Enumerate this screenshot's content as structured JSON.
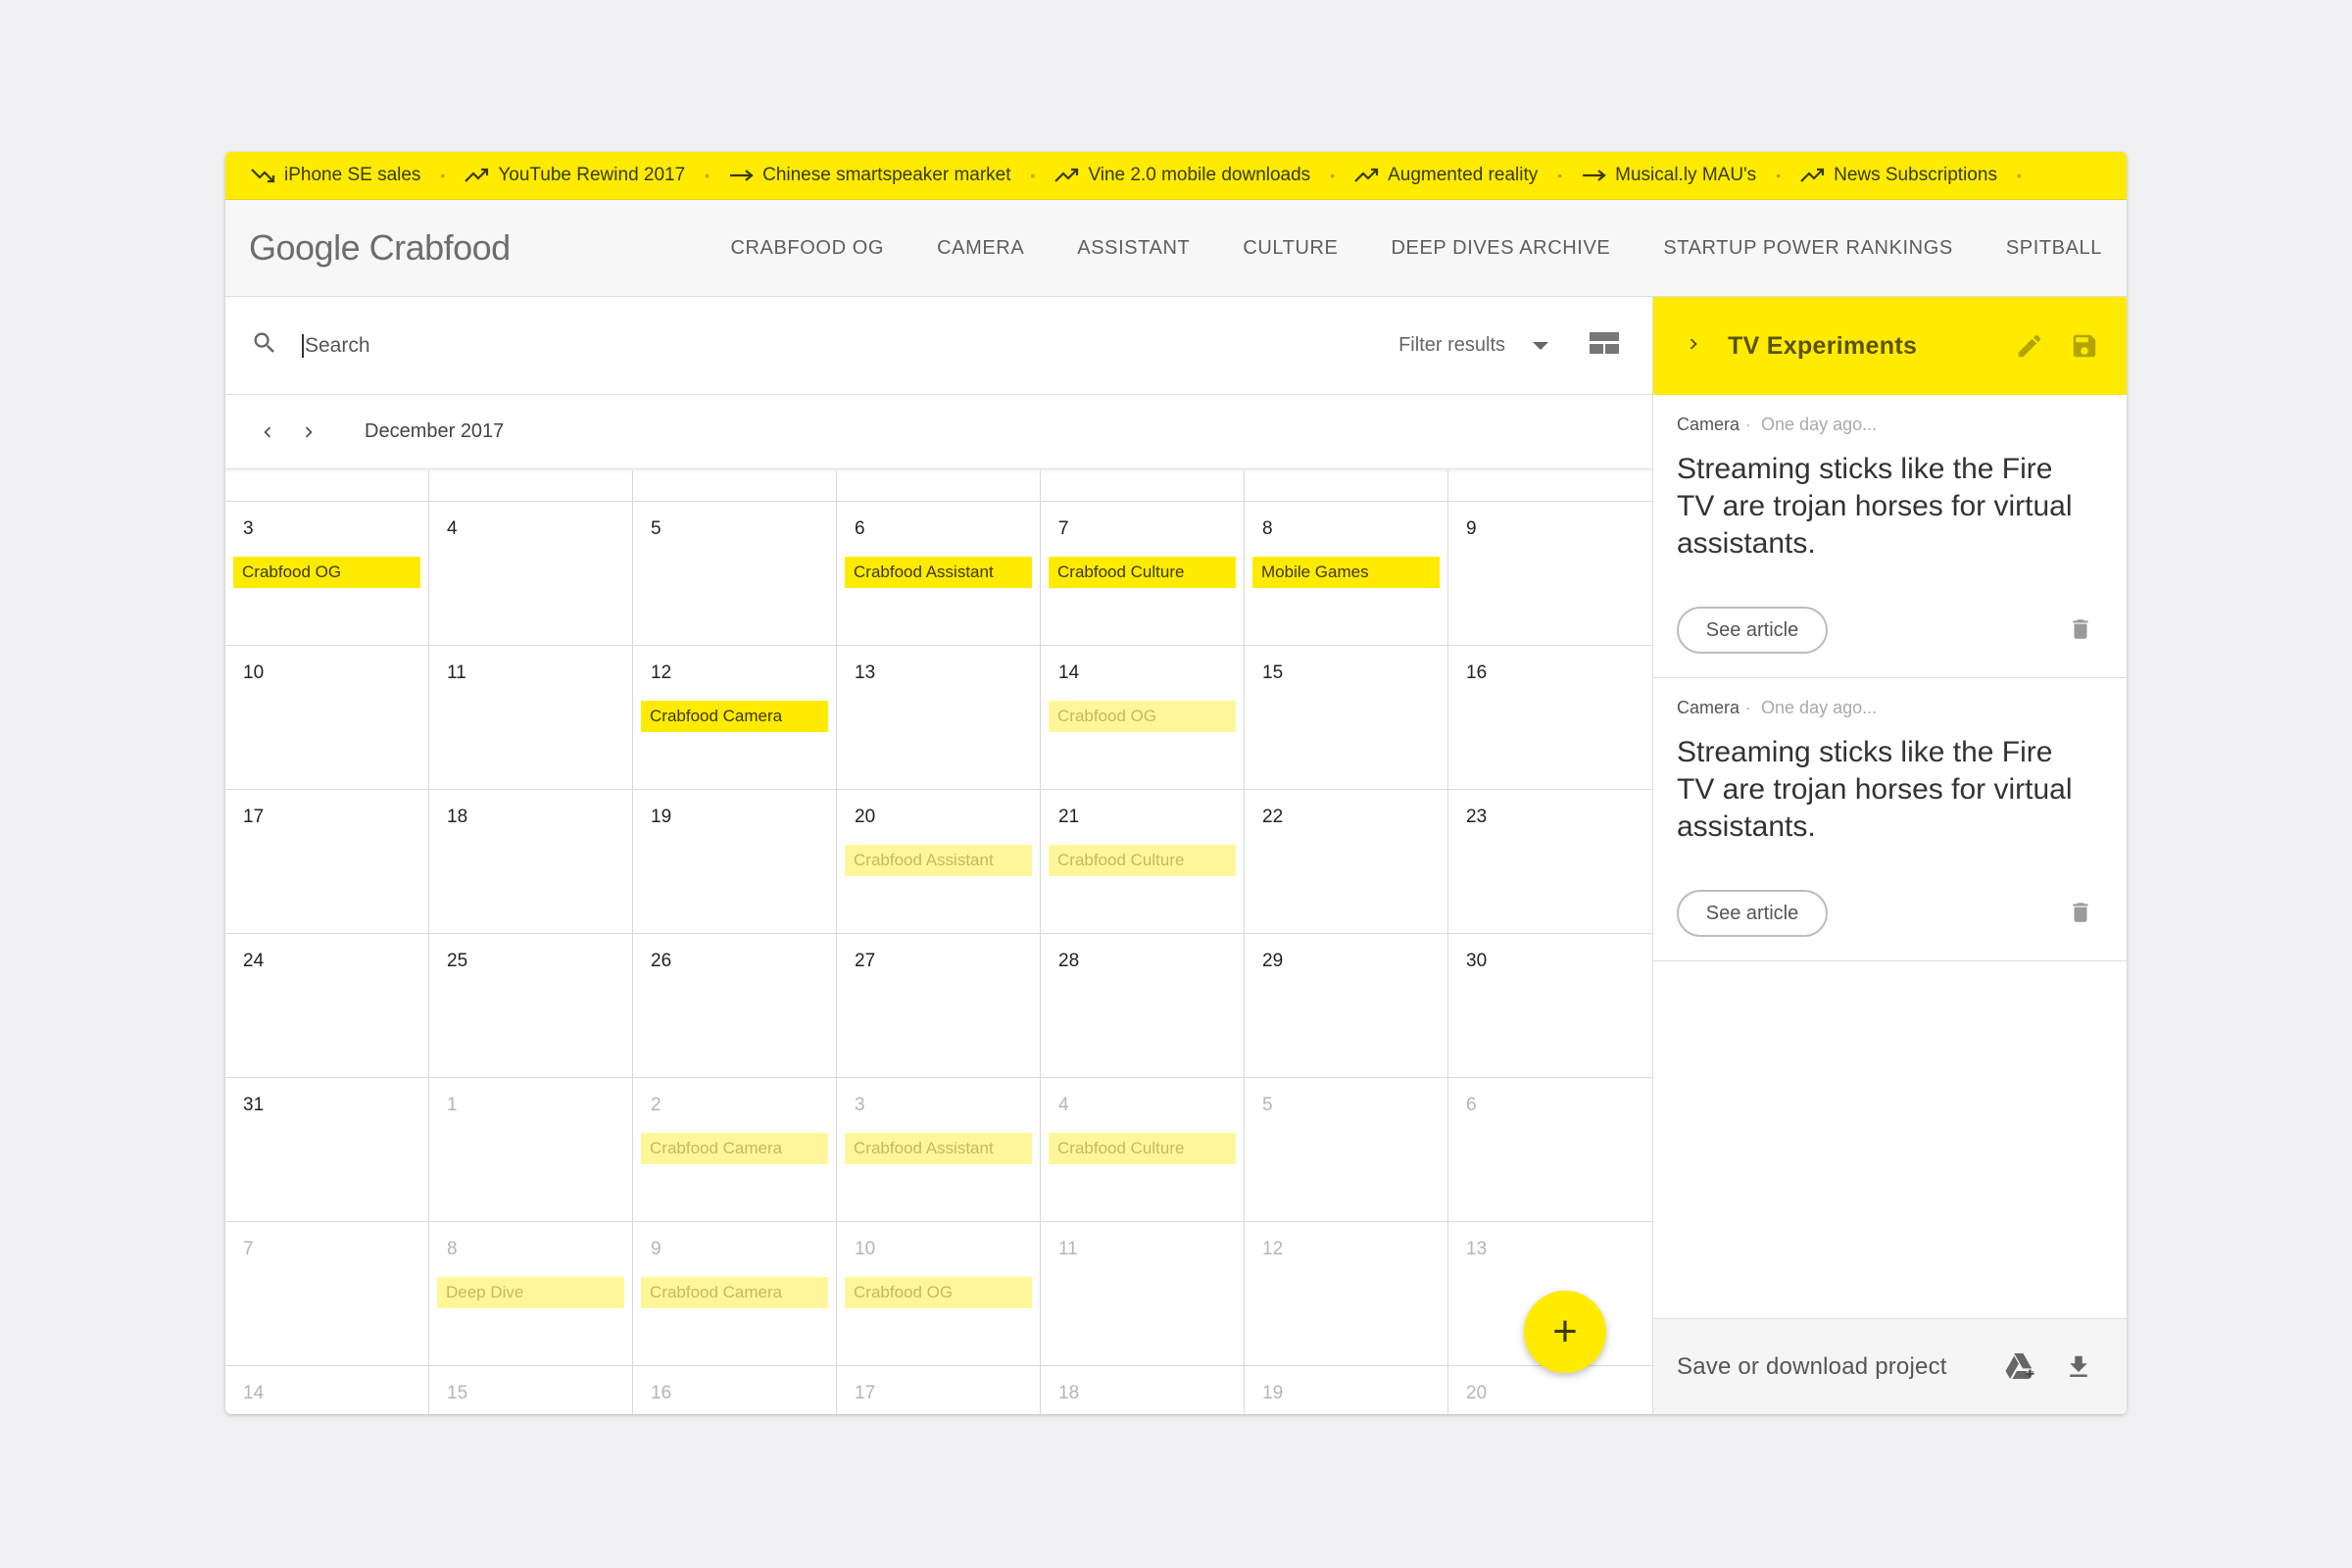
{
  "ticker": [
    {
      "label": "iPhone SE sales",
      "trend": "down"
    },
    {
      "label": "YouTube Rewind 2017",
      "trend": "up"
    },
    {
      "label": "Chinese smartspeaker market",
      "trend": "flat"
    },
    {
      "label": "Vine 2.0 mobile downloads",
      "trend": "up"
    },
    {
      "label": "Augmented reality",
      "trend": "up"
    },
    {
      "label": "Musical.ly MAU's",
      "trend": "flat"
    },
    {
      "label": "News Subscriptions",
      "trend": "up"
    }
  ],
  "header": {
    "logo": "Google Crabfood",
    "nav": [
      "CRABFOOD OG",
      "CAMERA",
      "ASSISTANT",
      "CULTURE",
      "DEEP DIVES ARCHIVE",
      "STARTUP POWER RANKINGS",
      "SPITBALL"
    ]
  },
  "search": {
    "placeholder": "Search",
    "filter_label": "Filter results"
  },
  "calendar": {
    "month_label": "December 2017",
    "weeks": [
      [
        {
          "d": "3",
          "dim": false,
          "ev": "Crabfood OG",
          "evDim": false
        },
        {
          "d": "4",
          "dim": false
        },
        {
          "d": "5",
          "dim": false
        },
        {
          "d": "6",
          "dim": false,
          "ev": "Crabfood Assistant",
          "evDim": false
        },
        {
          "d": "7",
          "dim": false,
          "ev": "Crabfood Culture",
          "evDim": false
        },
        {
          "d": "8",
          "dim": false,
          "ev": "Mobile Games",
          "evDim": false
        },
        {
          "d": "9",
          "dim": false
        }
      ],
      [
        {
          "d": "10",
          "dim": false
        },
        {
          "d": "11",
          "dim": false
        },
        {
          "d": "12",
          "dim": false,
          "ev": "Crabfood Camera",
          "evDim": false
        },
        {
          "d": "13",
          "dim": false
        },
        {
          "d": "14",
          "dim": false,
          "ev": "Crabfood OG",
          "evDim": true
        },
        {
          "d": "15",
          "dim": false
        },
        {
          "d": "16",
          "dim": false
        }
      ],
      [
        {
          "d": "17",
          "dim": false
        },
        {
          "d": "18",
          "dim": false
        },
        {
          "d": "19",
          "dim": false
        },
        {
          "d": "20",
          "dim": false,
          "ev": "Crabfood Assistant",
          "evDim": true
        },
        {
          "d": "21",
          "dim": false,
          "ev": "Crabfood Culture",
          "evDim": true
        },
        {
          "d": "22",
          "dim": false
        },
        {
          "d": "23",
          "dim": false
        }
      ],
      [
        {
          "d": "24",
          "dim": false
        },
        {
          "d": "25",
          "dim": false
        },
        {
          "d": "26",
          "dim": false
        },
        {
          "d": "27",
          "dim": false
        },
        {
          "d": "28",
          "dim": false
        },
        {
          "d": "29",
          "dim": false
        },
        {
          "d": "30",
          "dim": false
        }
      ],
      [
        {
          "d": "31",
          "dim": false
        },
        {
          "d": "1",
          "dim": true
        },
        {
          "d": "2",
          "dim": true,
          "ev": "Crabfood Camera",
          "evDim": true
        },
        {
          "d": "3",
          "dim": true,
          "ev": "Crabfood Assistant",
          "evDim": true
        },
        {
          "d": "4",
          "dim": true,
          "ev": "Crabfood Culture",
          "evDim": true
        },
        {
          "d": "5",
          "dim": true
        },
        {
          "d": "6",
          "dim": true
        }
      ],
      [
        {
          "d": "7",
          "dim": true
        },
        {
          "d": "8",
          "dim": true,
          "ev": "Deep Dive",
          "evDim": true
        },
        {
          "d": "9",
          "dim": true,
          "ev": "Crabfood Camera",
          "evDim": true
        },
        {
          "d": "10",
          "dim": true,
          "ev": "Crabfood OG",
          "evDim": true
        },
        {
          "d": "11",
          "dim": true
        },
        {
          "d": "12",
          "dim": true
        },
        {
          "d": "13",
          "dim": true
        }
      ],
      [
        {
          "d": "14",
          "dim": true
        },
        {
          "d": "15",
          "dim": true
        },
        {
          "d": "16",
          "dim": true
        },
        {
          "d": "17",
          "dim": true
        },
        {
          "d": "18",
          "dim": true
        },
        {
          "d": "19",
          "dim": true
        },
        {
          "d": "20",
          "dim": true
        }
      ]
    ]
  },
  "fab": {
    "label": "+"
  },
  "panel": {
    "title": "TV Experiments",
    "cards": [
      {
        "category": "Camera",
        "time": "One day ago...",
        "title": "Streaming sticks like the Fire TV are trojan horses for virtual assistants.",
        "button": "See article"
      },
      {
        "category": "Camera",
        "time": "One day ago...",
        "title": "Streaming sticks like the Fire TV are trojan horses for virtual assistants.",
        "button": "See article"
      }
    ],
    "footer_label": "Save or download project"
  },
  "colors": {
    "accent": "#ffeb00",
    "accent_dim": "#fff69a"
  },
  "icons": [
    "trend-down-icon",
    "trend-up-icon",
    "trend-flat-icon",
    "search-icon",
    "dropdown-caret-icon",
    "view-toggle-icon",
    "chevron-left-icon",
    "chevron-right-icon",
    "edit-icon",
    "save-icon",
    "trash-icon",
    "drive-add-icon",
    "download-icon"
  ]
}
